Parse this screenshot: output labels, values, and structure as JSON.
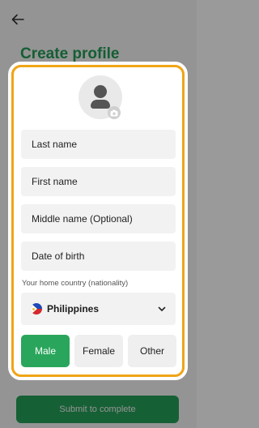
{
  "header": {
    "back_icon": "arrow-left-icon",
    "title": "Create profile"
  },
  "form": {
    "avatar_icon": "user-avatar-icon",
    "camera_icon": "camera-icon",
    "last_name_placeholder": "Last name",
    "first_name_placeholder": "First name",
    "middle_name_placeholder": "Middle name (Optional)",
    "dob_placeholder": "Date of birth",
    "country_label": "Your home country (nationality)",
    "country_value": "Philippines",
    "country_flag": "philippines-flag-icon",
    "gender_options": [
      "Male",
      "Female",
      "Other"
    ],
    "gender_selected": "Male"
  },
  "footer": {
    "submit_label": "Submit to complete"
  },
  "colors": {
    "accent_green": "#2aa65c",
    "highlight_orange": "#f0a516"
  }
}
